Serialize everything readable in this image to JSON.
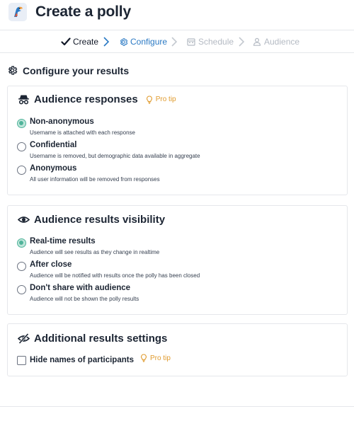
{
  "header": {
    "title": "Create a polly",
    "logo_icon": "polly-parrot-logo"
  },
  "stepper": {
    "steps": [
      {
        "label": "Create",
        "state": "done",
        "icon": "check-icon"
      },
      {
        "label": "Configure",
        "state": "active",
        "icon": "gear-icon"
      },
      {
        "label": "Schedule",
        "state": "disabled",
        "icon": "calendar-icon"
      },
      {
        "label": "Audience",
        "state": "disabled",
        "icon": "user-icon"
      }
    ],
    "colors": {
      "active": "#2a79c4",
      "disabled": "#b4bac3"
    }
  },
  "section": {
    "title": "Configure your results",
    "icon": "gear-icon"
  },
  "audience_responses": {
    "title": "Audience responses",
    "icon": "incognito-icon",
    "pro_tip": "Pro tip",
    "options": [
      {
        "label": "Non-anonymous",
        "description": "Username is attached with each response",
        "checked": true
      },
      {
        "label": "Confidential",
        "description": "Username is removed, but demographic data available in aggregate",
        "checked": false
      },
      {
        "label": "Anonymous",
        "description": "All user information will be removed from responses",
        "checked": false
      }
    ]
  },
  "results_visibility": {
    "title": "Audience results visibility",
    "icon": "eye-icon",
    "options": [
      {
        "label": "Real-time results",
        "description": "Audience will see results as they change in realtime",
        "checked": true
      },
      {
        "label": "After close",
        "description": "Audience will be notified with results once the polly has been closed",
        "checked": false
      },
      {
        "label": "Don't share with audience",
        "description": "Audience will not be shown the polly results",
        "checked": false
      }
    ]
  },
  "additional_settings": {
    "title": "Additional results settings",
    "icon": "eye-slash-icon",
    "checkbox_label": "Hide names of participants",
    "checked": false,
    "pro_tip": "Pro tip"
  },
  "colors": {
    "accent_green": "#4fb39a",
    "pro_tip": "#e09b2e"
  }
}
